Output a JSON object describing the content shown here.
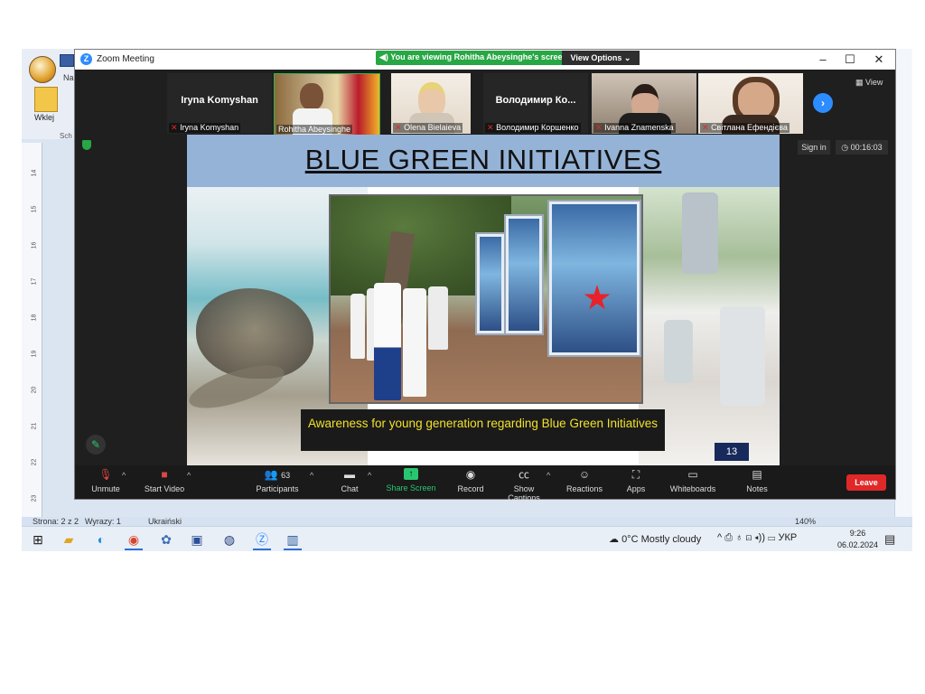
{
  "word": {
    "ribbon_tab": "Na",
    "paste_label": "Wklej",
    "clipboard_group": "Sch",
    "ruler_numbers": [
      "14",
      "15",
      "16",
      "17",
      "18",
      "19",
      "20",
      "21",
      "22",
      "23"
    ],
    "status": {
      "page": "Strona: 2 z 2",
      "words": "Wyrazy: 1",
      "language": "Ukraiński",
      "zoom": "140%"
    }
  },
  "zoom": {
    "window_title": "Zoom Meeting",
    "banner_text": "You are viewing Rohitha Abeysinghe's screen",
    "view_options": "View Options",
    "view_label": "View",
    "sign_in": "Sign in",
    "timer": "00:16:03",
    "participants": [
      {
        "big_name": "Iryna Komyshan",
        "label": "Iryna Komyshan"
      },
      {
        "big_name": "",
        "label": "Rohitha Abeysinghe"
      },
      {
        "big_name": "",
        "label": "Olena Bielaieva"
      },
      {
        "big_name": "Володимир Ко...",
        "label": "Володимир Коршенко"
      },
      {
        "big_name": "",
        "label": "Ivanna Znamenska"
      },
      {
        "big_name": "",
        "label": "Світлана Ефендієва"
      }
    ],
    "toolbar": {
      "unmute": "Unmute",
      "start_video": "Start Video",
      "participants": "Participants",
      "participants_count": "63",
      "chat": "Chat",
      "share_screen": "Share Screen",
      "record": "Record",
      "show_captions": "Show Captions",
      "reactions": "Reactions",
      "apps": "Apps",
      "whiteboards": "Whiteboards",
      "notes": "Notes",
      "leave": "Leave"
    }
  },
  "slide": {
    "title": "BLUE GREEN INITIATIVES",
    "caption": "Awareness for young generation regarding Blue Green Initiatives",
    "page_number": "13"
  },
  "taskbar": {
    "weather": "0°C  Mostly cloudy",
    "lang": "УКР",
    "time": "9:26",
    "date": "06.02.2024"
  }
}
